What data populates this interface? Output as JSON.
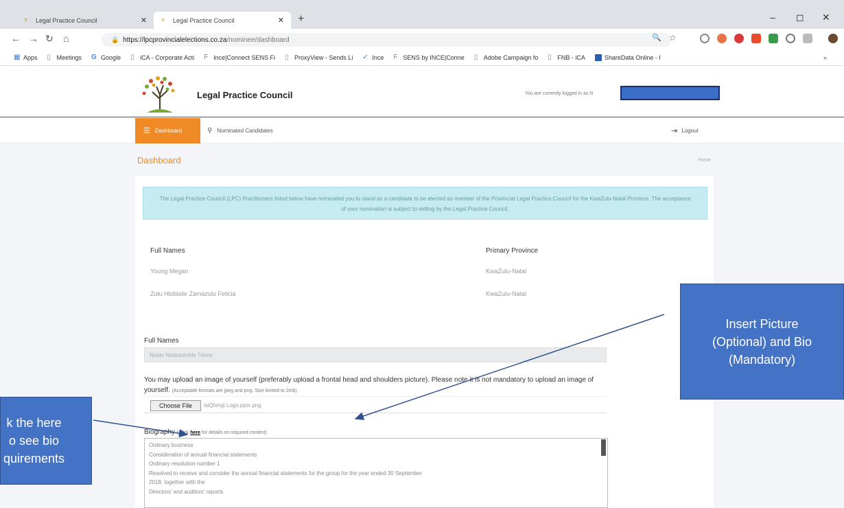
{
  "browser": {
    "tabs": [
      {
        "title": "Legal Practice Council",
        "active": false
      },
      {
        "title": "Legal Practice Council",
        "active": true
      }
    ],
    "url_host": "https://lpcprovincialelections.co.za",
    "url_path": "/nominee/dashboard",
    "bookmarks": [
      "Apps",
      "Meetings",
      "Google",
      "iCA - Corporate Acti",
      "Ince|Connect SENS Fi",
      "ProxyView - Sends Li",
      "Ince",
      "SENS by INCE|Conne",
      "Adobe Campaign fo",
      "FNB - iCA",
      "ShareData Online - I"
    ]
  },
  "site": {
    "brand": "Legal Practice Council",
    "logged_in_text": "You are currently logged in as N",
    "nav": {
      "dashboard": "Dashboard",
      "nominated": "Nominated Candidates",
      "logout": "Logout"
    }
  },
  "page": {
    "title": "Dashboard",
    "breadcrumb": "Home",
    "alert": "The Legal Practice Council (LPC) Practitioners listed below have nominated you to stand as a candidate to be elected as member of the Provincial Legal Practice Council for the KwaZulu-Natal Province. The acceptance of your nomination is subject to vetting by the Legal Practice Council.",
    "table": {
      "headers": [
        "Full Names",
        "Primary Province"
      ],
      "rows": [
        [
          "Young Megan",
          "KwaZulu-Natal"
        ],
        [
          "Zulu Hlobisile Zamazulu Felicia",
          "KwaZulu-Natal"
        ]
      ]
    },
    "form": {
      "full_names_label": "Full Names",
      "full_names_value": "Naido Ndabezinhle Trevor",
      "upload_note": "You may upload an image of yourself (preferably upload a frontal head and shoulders picture). Please note it is not mandatory to upload an image of yourself.",
      "upload_small": "(Acceptable formats are jpeg and png. Size limited to 2mb)",
      "choose_file": "Choose File",
      "file_name": "isiQhingi Logo.pptx.png",
      "bio_label": "Biography",
      "bio_hint_pre": "(Click",
      "bio_hint_link": "here",
      "bio_hint_post": "for details on required content)",
      "bio_lines": [
        "Ordinary business",
        "Consideration of annual financial statements",
        "Ordinary resolution number 1",
        "Resolved to receive and consider the annual financial statements for the group for the year ended 30 September",
        "2018, together with the",
        "Directors' and auditors' reports"
      ]
    }
  },
  "callouts": {
    "right": "Insert Picture\n(Optional) and Bio\n(Mandatory)",
    "left": "k the here\no see bio\nquirements"
  },
  "colors": {
    "accent": "#f08a24",
    "alert_bg": "#c6ebf2",
    "callout": "#4472c4"
  }
}
